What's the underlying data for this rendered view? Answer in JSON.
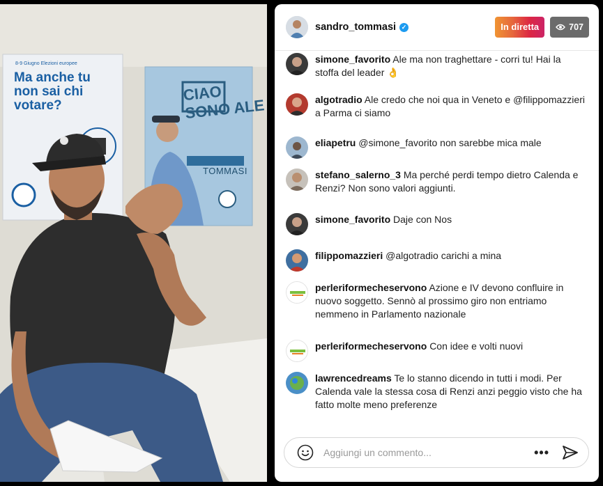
{
  "header": {
    "username": "sandro_tommasi",
    "live_label": "In diretta",
    "viewer_count": "707"
  },
  "video": {
    "poster_left": {
      "small_text": "8-9 Giugno Elezioni europee",
      "headline": "Ma anche tu non sai chi votare?"
    },
    "poster_right": {
      "title": "CIAO SONO ALE",
      "name": "TOMMASI"
    }
  },
  "comments": [
    {
      "user": "simone_favorito",
      "text": "Ale ma non traghettare - corri tu! Hai la stoffa del leader 👌"
    },
    {
      "user": "algotradio",
      "text": "Ale credo che noi qua in Veneto e @filippomazzieri a Parma ci siamo"
    },
    {
      "user": "eliapetru",
      "text": "@simone_favorito non sarebbe mica male"
    },
    {
      "user": "stefano_salerno_3",
      "text": "Ma perché perdi tempo dietro Calenda e Renzi? Non sono valori aggiunti."
    },
    {
      "user": "simone_favorito",
      "text": "Daje con Nos"
    },
    {
      "user": "filippomazzieri",
      "text": "@algotradio carichi a mina"
    },
    {
      "user": "perleriformecheservono",
      "text": "Azione e IV devono confluire in nuovo soggetto. Sennò al prossimo giro non entriamo nemmeno in Parlamento nazionale"
    },
    {
      "user": "perleriformecheservono",
      "text": "Con idee e volti nuovi"
    },
    {
      "user": "lawrencedreams",
      "text": "Te lo stanno dicendo in tutti i modi. Per Calenda vale la stessa cosa di Renzi anzi peggio visto che ha fatto molte meno preferenze"
    }
  ],
  "footer": {
    "placeholder": "Aggiungi un commento..."
  },
  "colors": {
    "live_badge_start": "#f09433",
    "live_badge_end": "#cc2366",
    "verified": "#1d9bf0",
    "viewer_badge": "#6b6b6b"
  },
  "icons": [
    "eye-icon",
    "verified-badge-icon",
    "emoji-icon",
    "more-icon",
    "send-icon"
  ]
}
